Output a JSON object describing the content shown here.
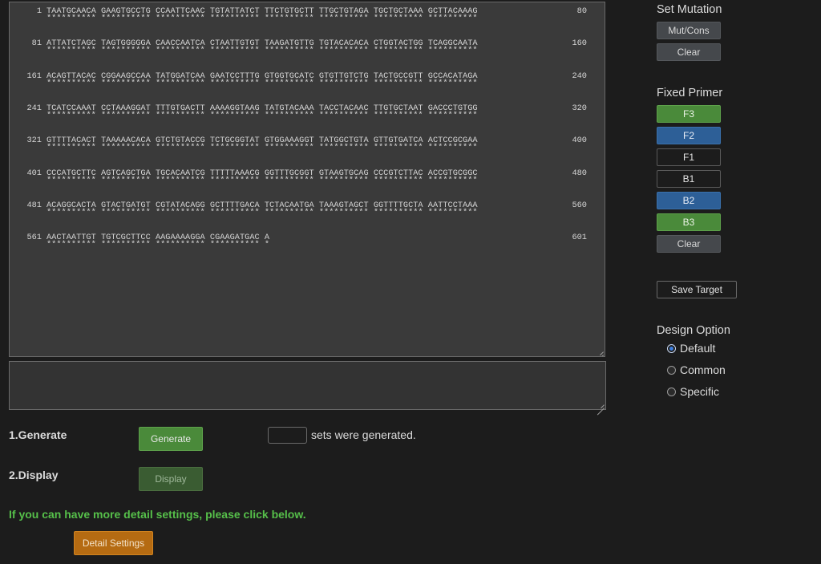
{
  "sequence": {
    "rows": [
      {
        "start": "1",
        "seq": "TAATGCAACA GAAGTGCCTG CCAATTCAAC TGTATTATCT TTCTGTGCTT TTGCTGTAGA TGCTGCTAAA GCTTACAAAG",
        "stars": "********** ********** ********** ********** ********** ********** ********** **********",
        "end": "80"
      },
      {
        "start": "81",
        "seq": "ATTATCTAGC TAGTGGGGGA CAACCAATCA CTAATTGTGT TAAGATGTTG TGTACACACA CTGGTACTGG TCAGGCAATA",
        "stars": "********** ********** ********** ********** ********** ********** ********** **********",
        "end": "160"
      },
      {
        "start": "161",
        "seq": "ACAGTTACAC CGGAAGCCAA TATGGATCAA GAATCCTTTG GTGGTGCATC GTGTTGTCTG TACTGCCGTT GCCACATAGA",
        "stars": "********** ********** ********** ********** ********** ********** ********** **********",
        "end": "240"
      },
      {
        "start": "241",
        "seq": "TCATCCAAAT CCTAAAGGAT TTTGTGACTT AAAAGGTAAG TATGTACAAA TACCTACAAC TTGTGCTAAT GACCCTGTGG",
        "stars": "********** ********** ********** ********** ********** ********** ********** **********",
        "end": "320"
      },
      {
        "start": "321",
        "seq": "GTTTTACACT TAAAAACACA GTCTGTACCG TCTGCGGTAT GTGGAAAGGT TATGGCTGTA GTTGTGATCA ACTCCGCGAA",
        "stars": "********** ********** ********** ********** ********** ********** ********** **********",
        "end": "400"
      },
      {
        "start": "401",
        "seq": "CCCATGCTTC AGTCAGCTGA TGCACAATCG TTTTTAAACG GGTTTGCGGT GTAAGTGCAG CCCGTCTTAC ACCGTGCGGC",
        "stars": "********** ********** ********** ********** ********** ********** ********** **********",
        "end": "480"
      },
      {
        "start": "481",
        "seq": "ACAGGCACTA GTACTGATGT CGTATACAGG GCTTTTGACA TCTACAATGA TAAAGTAGCT GGTTTTGCTA AATTCCTAAA",
        "stars": "********** ********** ********** ********** ********** ********** ********** **********",
        "end": "560"
      },
      {
        "start": "561",
        "seq": "AACTAATTGT TGTCGCTTCC AAGAAAAGGA CGAAGATGAC A",
        "stars": "********** ********** ********** ********** *",
        "end": "601"
      }
    ]
  },
  "steps": {
    "generate_label": "1.Generate",
    "generate_button": "Generate",
    "generated_count": "",
    "generated_suffix": "sets were generated.",
    "display_label": "2.Display",
    "display_button": "Display"
  },
  "hint_text": "If you can have more detail settings, please click below.",
  "detail_settings_button": "Detail Settings",
  "sidebar": {
    "set_mutation_title": "Set Mutation",
    "mut_cons_button": "Mut/Cons",
    "mutation_clear_button": "Clear",
    "fixed_primer_title": "Fixed Primer",
    "primers": [
      "F3",
      "F2",
      "F1",
      "B1",
      "B2",
      "B3"
    ],
    "primer_clear_button": "Clear",
    "save_target_button": "Save Target",
    "design_option_title": "Design Option",
    "design_options": [
      "Default",
      "Common",
      "Specific"
    ],
    "design_option_selected": "Default"
  },
  "colors": {
    "background": "#1c1c1c",
    "green": "#4a8a3a",
    "blue": "#2d5f97",
    "orange": "#b56b12",
    "hint_green": "#56c04a"
  }
}
